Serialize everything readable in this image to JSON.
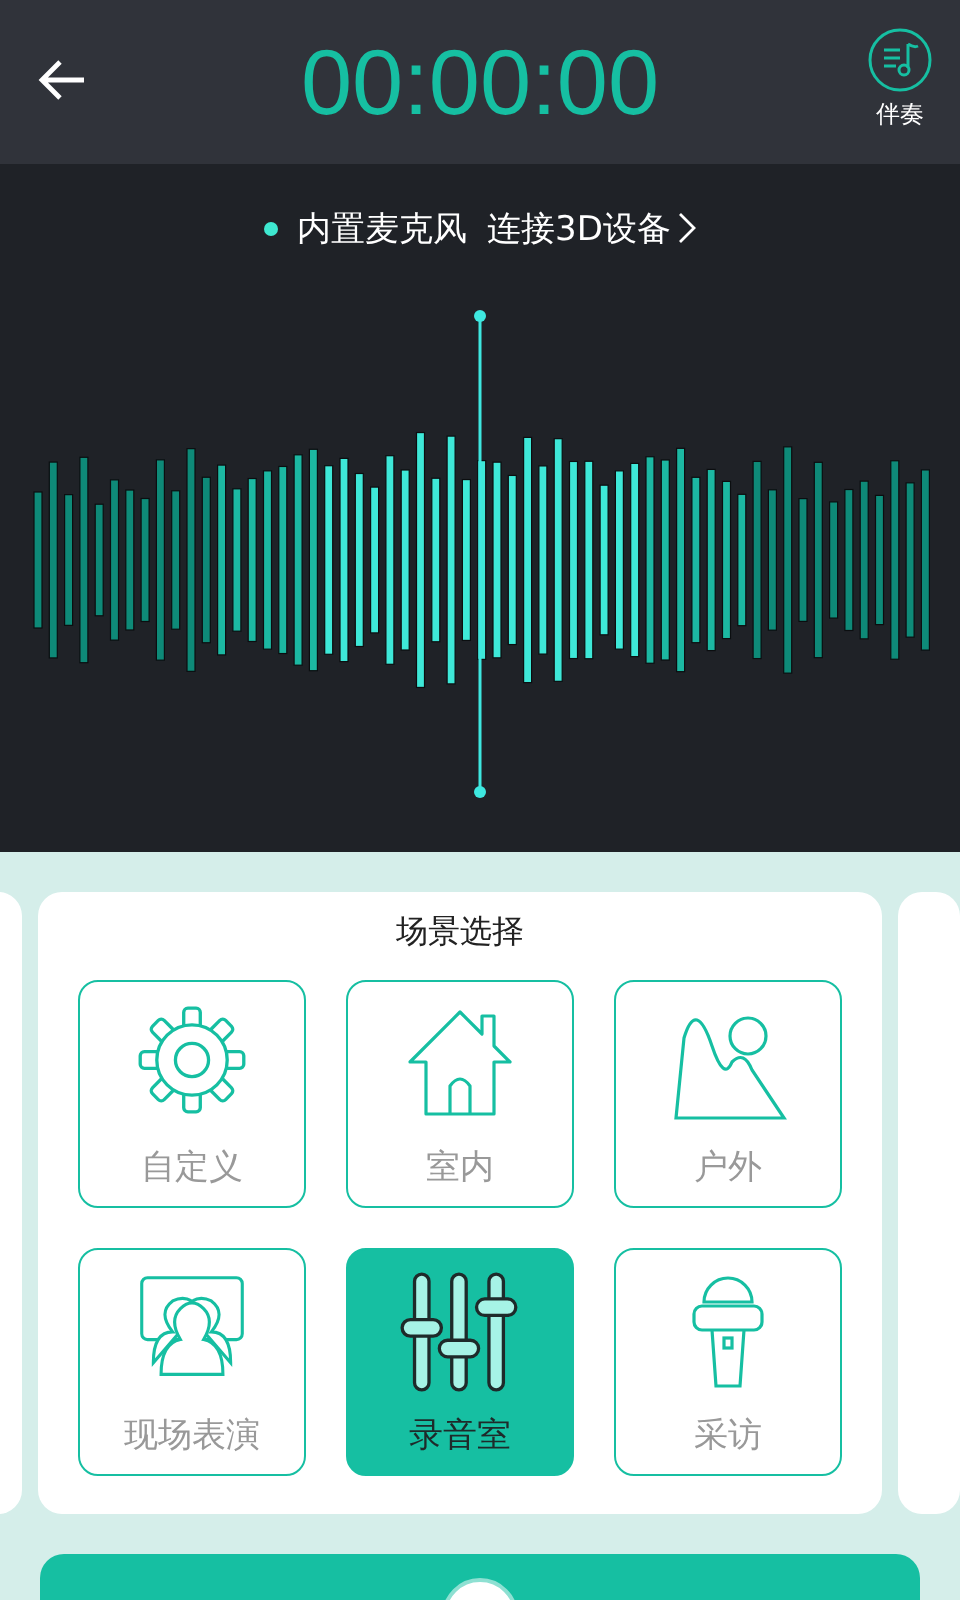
{
  "header": {
    "timer": "00:00:00",
    "accompaniment_label": "伴奏"
  },
  "input": {
    "source": "内置麦克风",
    "connect_link": "连接3D设备"
  },
  "scene_panel": {
    "title": "场景选择",
    "scenes": [
      {
        "label": "自定义",
        "selected": false
      },
      {
        "label": "室内",
        "selected": false
      },
      {
        "label": "户外",
        "selected": false
      },
      {
        "label": "现场表演",
        "selected": false
      },
      {
        "label": "录音室",
        "selected": true
      },
      {
        "label": "采访",
        "selected": false
      }
    ]
  }
}
